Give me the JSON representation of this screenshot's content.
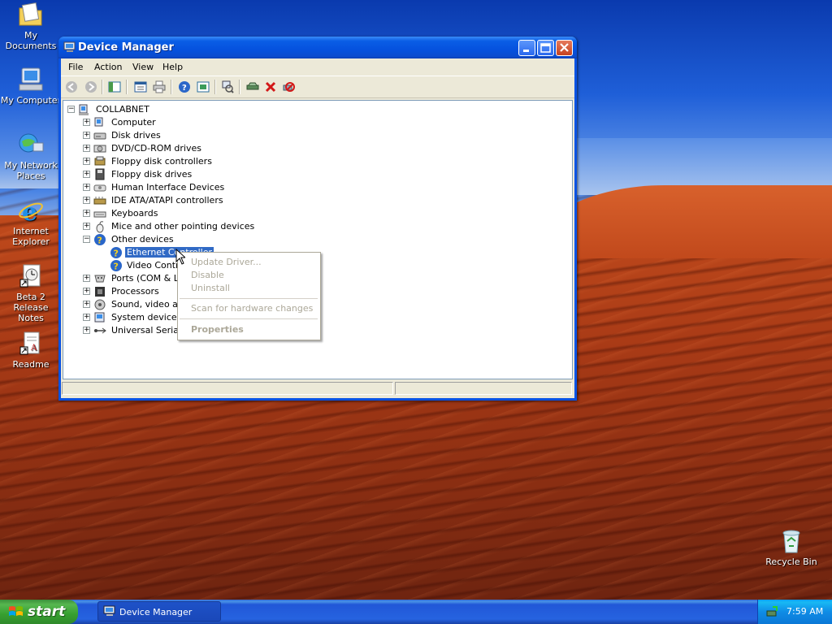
{
  "desktop": {
    "icons": [
      {
        "label": "My Documents",
        "icon": "my-documents-icon"
      },
      {
        "label": "My Computer",
        "icon": "my-computer-icon"
      },
      {
        "label_line1": "My Network",
        "label_line2": "Places",
        "icon": "network-places-icon"
      },
      {
        "label_line1": "Internet",
        "label_line2": "Explorer",
        "icon": "internet-explorer-icon"
      },
      {
        "label_line1": "Beta 2 Release",
        "label_line2": "Notes",
        "icon": "release-notes-icon"
      },
      {
        "label": "Readme",
        "icon": "readme-icon"
      },
      {
        "label": "Recycle Bin",
        "icon": "recycle-bin-icon"
      }
    ]
  },
  "window": {
    "title": "Device Manager",
    "menu": [
      "File",
      "Action",
      "View",
      "Help"
    ],
    "toolbar": [
      "back-icon",
      "forward-icon",
      "show-hide-tree-icon",
      "properties-icon",
      "print-icon",
      "help-icon",
      "view-icon",
      "scan-hardware-icon",
      "update-driver-icon",
      "uninstall-icon",
      "disable-icon"
    ],
    "tree": {
      "root": "COLLABNET",
      "categories": [
        {
          "label": "Computer",
          "icon": "computer-icon"
        },
        {
          "label": "Disk drives",
          "icon": "disk-drive-icon"
        },
        {
          "label": "DVD/CD-ROM drives",
          "icon": "cdrom-icon"
        },
        {
          "label": "Floppy disk controllers",
          "icon": "floppy-controller-icon"
        },
        {
          "label": "Floppy disk drives",
          "icon": "floppy-drive-icon"
        },
        {
          "label": "Human Interface Devices",
          "icon": "hid-icon"
        },
        {
          "label": "IDE ATA/ATAPI controllers",
          "icon": "ide-controller-icon"
        },
        {
          "label": "Keyboards",
          "icon": "keyboard-icon"
        },
        {
          "label": "Mice and other pointing devices",
          "icon": "mouse-icon"
        },
        {
          "label": "Other devices",
          "icon": "unknown-device-icon",
          "expanded": true,
          "children": [
            "Ethernet Controller",
            "Video Controller (VGA Compatible)"
          ]
        },
        {
          "label": "Ports (COM & LPT)",
          "icon": "ports-icon"
        },
        {
          "label": "Processors",
          "icon": "processor-icon"
        },
        {
          "label": "Sound, video and game controllers",
          "icon": "sound-icon"
        },
        {
          "label": "System devices",
          "icon": "system-device-icon"
        },
        {
          "label": "Universal Serial Bus controllers",
          "icon": "usb-icon"
        }
      ],
      "selected": "Ethernet Controller"
    },
    "context_menu": [
      "Update Driver...",
      "Disable",
      "Uninstall",
      "Scan for hardware changes",
      "Properties"
    ]
  },
  "taskbar": {
    "start_label": "start",
    "tasks": [
      "Device Manager"
    ],
    "clock": "7:59 AM"
  }
}
